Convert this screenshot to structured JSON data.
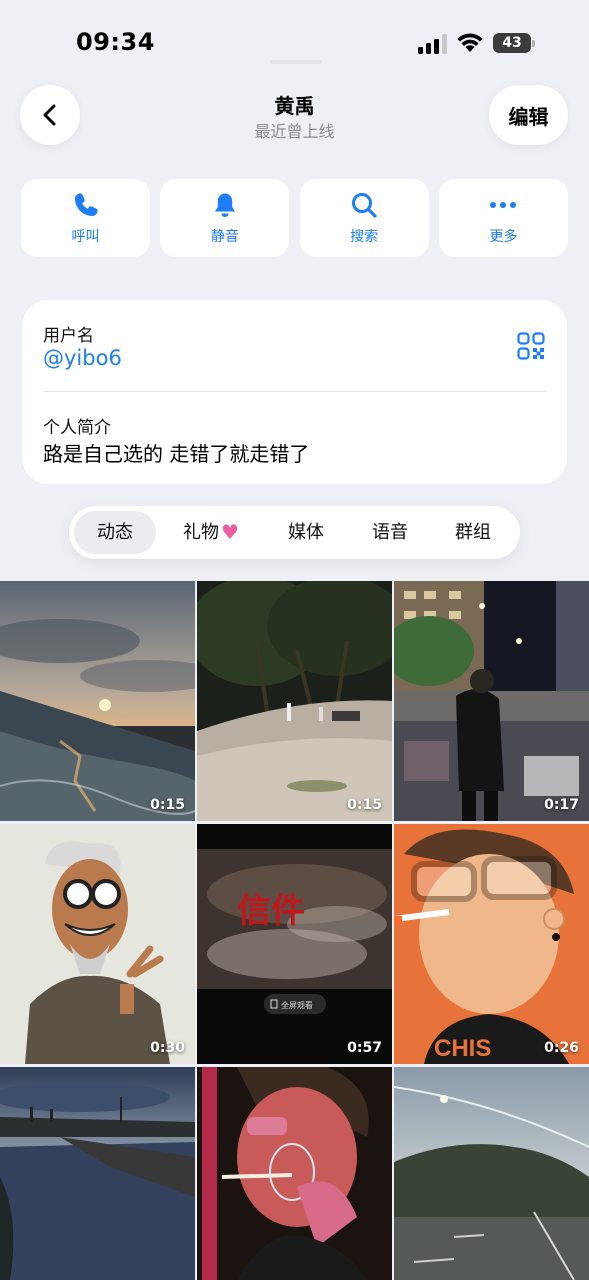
{
  "status_bar": {
    "time": "09:34",
    "battery": "43"
  },
  "header": {
    "title": "黄禹",
    "subtitle": "最近曾上线",
    "edit_label": "编辑"
  },
  "actions": [
    {
      "label": "呼叫",
      "icon": "phone-icon"
    },
    {
      "label": "静音",
      "icon": "bell-icon"
    },
    {
      "label": "搜索",
      "icon": "search-icon"
    },
    {
      "label": "更多",
      "icon": "more-icon"
    }
  ],
  "profile": {
    "username_label": "用户名",
    "username": "@yibo6",
    "bio_label": "个人简介",
    "bio": "路是自己选的 走错了就走错了"
  },
  "tabs": [
    {
      "label": "动态",
      "active": true
    },
    {
      "label": "礼物",
      "active": false,
      "badge": "heart-gift-icon"
    },
    {
      "label": "媒体",
      "active": false
    },
    {
      "label": "语音",
      "active": false
    },
    {
      "label": "群组",
      "active": false
    }
  ],
  "media": [
    {
      "duration": "0:15",
      "scene": "sunset-sea"
    },
    {
      "duration": "0:15",
      "scene": "night-beach"
    },
    {
      "duration": "0:17",
      "scene": "night-market"
    },
    {
      "duration": "0:30",
      "scene": "cartoon-old-man"
    },
    {
      "duration": "0:57",
      "scene": "video-text",
      "overlay_text": "信件",
      "overlay_hint": "全屏观看"
    },
    {
      "duration": "0:26",
      "scene": "cartoon-boy"
    },
    {
      "duration": "",
      "scene": "dusk-river"
    },
    {
      "duration": "",
      "scene": "art-portrait"
    },
    {
      "duration": "",
      "scene": "evening-road"
    }
  ],
  "colors": {
    "accent": "#1b7ef7",
    "background": "#eff0f5",
    "card": "#ffffff"
  }
}
